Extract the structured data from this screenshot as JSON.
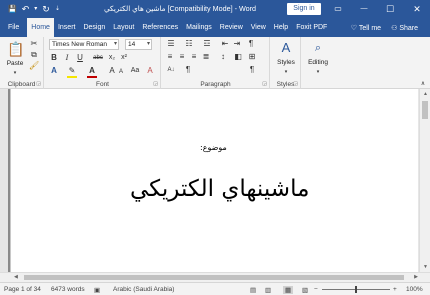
{
  "titlebar": {
    "title": "ماشين هاي الكتريكي [Compatibility Mode]  -  Word",
    "signin_label": "Sign in",
    "minimize": "—",
    "maximize": "☐",
    "close": "✕",
    "save_icon": "💾",
    "undo_icon": "↶",
    "redo_icon": "↻",
    "qat_more": "▾"
  },
  "tabs": {
    "items": [
      "File",
      "Home",
      "Insert",
      "Design",
      "Layout",
      "References",
      "Mailings",
      "Review",
      "View",
      "Help",
      "Foxit PDF"
    ],
    "active": "Home",
    "tell_me": "Tell me",
    "share": "Share"
  },
  "ribbon": {
    "clipboard": {
      "label": "Clipboard",
      "paste": "Paste"
    },
    "font": {
      "label": "Font",
      "font_name": "Times New Roman",
      "font_size": "14",
      "bold": "B",
      "italic": "I",
      "underline": "U",
      "strike": "abc",
      "subscript": "x₂",
      "superscript": "x²",
      "grow": "A",
      "shrink": "A",
      "case": "Aa",
      "clear": "A"
    },
    "paragraph": {
      "label": "Paragraph"
    },
    "styles": {
      "label": "Styles",
      "button": "Styles"
    },
    "editing": {
      "button": "Editing"
    }
  },
  "document": {
    "subject": "موضوع:",
    "heading": "ماشينهاي الكتريكي"
  },
  "status": {
    "page": "Page 1 of 34",
    "words": "6473 words",
    "language": "Arabic (Saudi Arabia)",
    "zoom": "100%",
    "zoom_out": "−",
    "zoom_in": "+"
  },
  "colors": {
    "brand": "#2b579a",
    "ribbon_bg": "#f3f3f3",
    "highlight": "#f5e500",
    "font_color": "#c00000"
  }
}
